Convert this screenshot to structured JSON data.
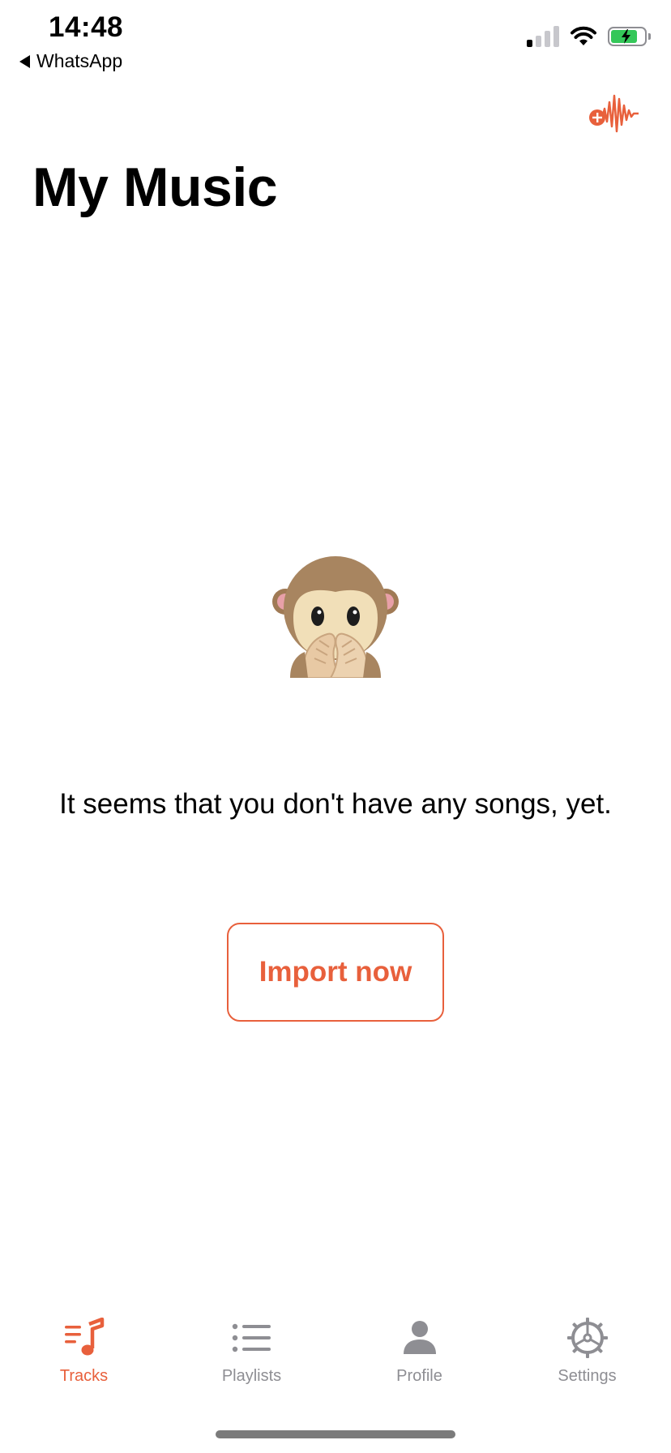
{
  "status_bar": {
    "time": "14:48",
    "back_app": "WhatsApp"
  },
  "header": {
    "title": "My Music",
    "add_icon": "add-audio-waveform-icon"
  },
  "empty_state": {
    "emoji_icon": "see-no-evil-monkey-icon",
    "message": "It seems that you don't have any songs, yet.",
    "button_label": "Import now"
  },
  "tabs": [
    {
      "label": "Tracks",
      "icon": "music-note-list-icon",
      "active": true
    },
    {
      "label": "Playlists",
      "icon": "list-icon",
      "active": false
    },
    {
      "label": "Profile",
      "icon": "person-icon",
      "active": false
    },
    {
      "label": "Settings",
      "icon": "gear-icon",
      "active": false
    }
  ],
  "colors": {
    "accent": "#e8603c",
    "inactive": "#8e8e93",
    "battery": "#34c759"
  }
}
